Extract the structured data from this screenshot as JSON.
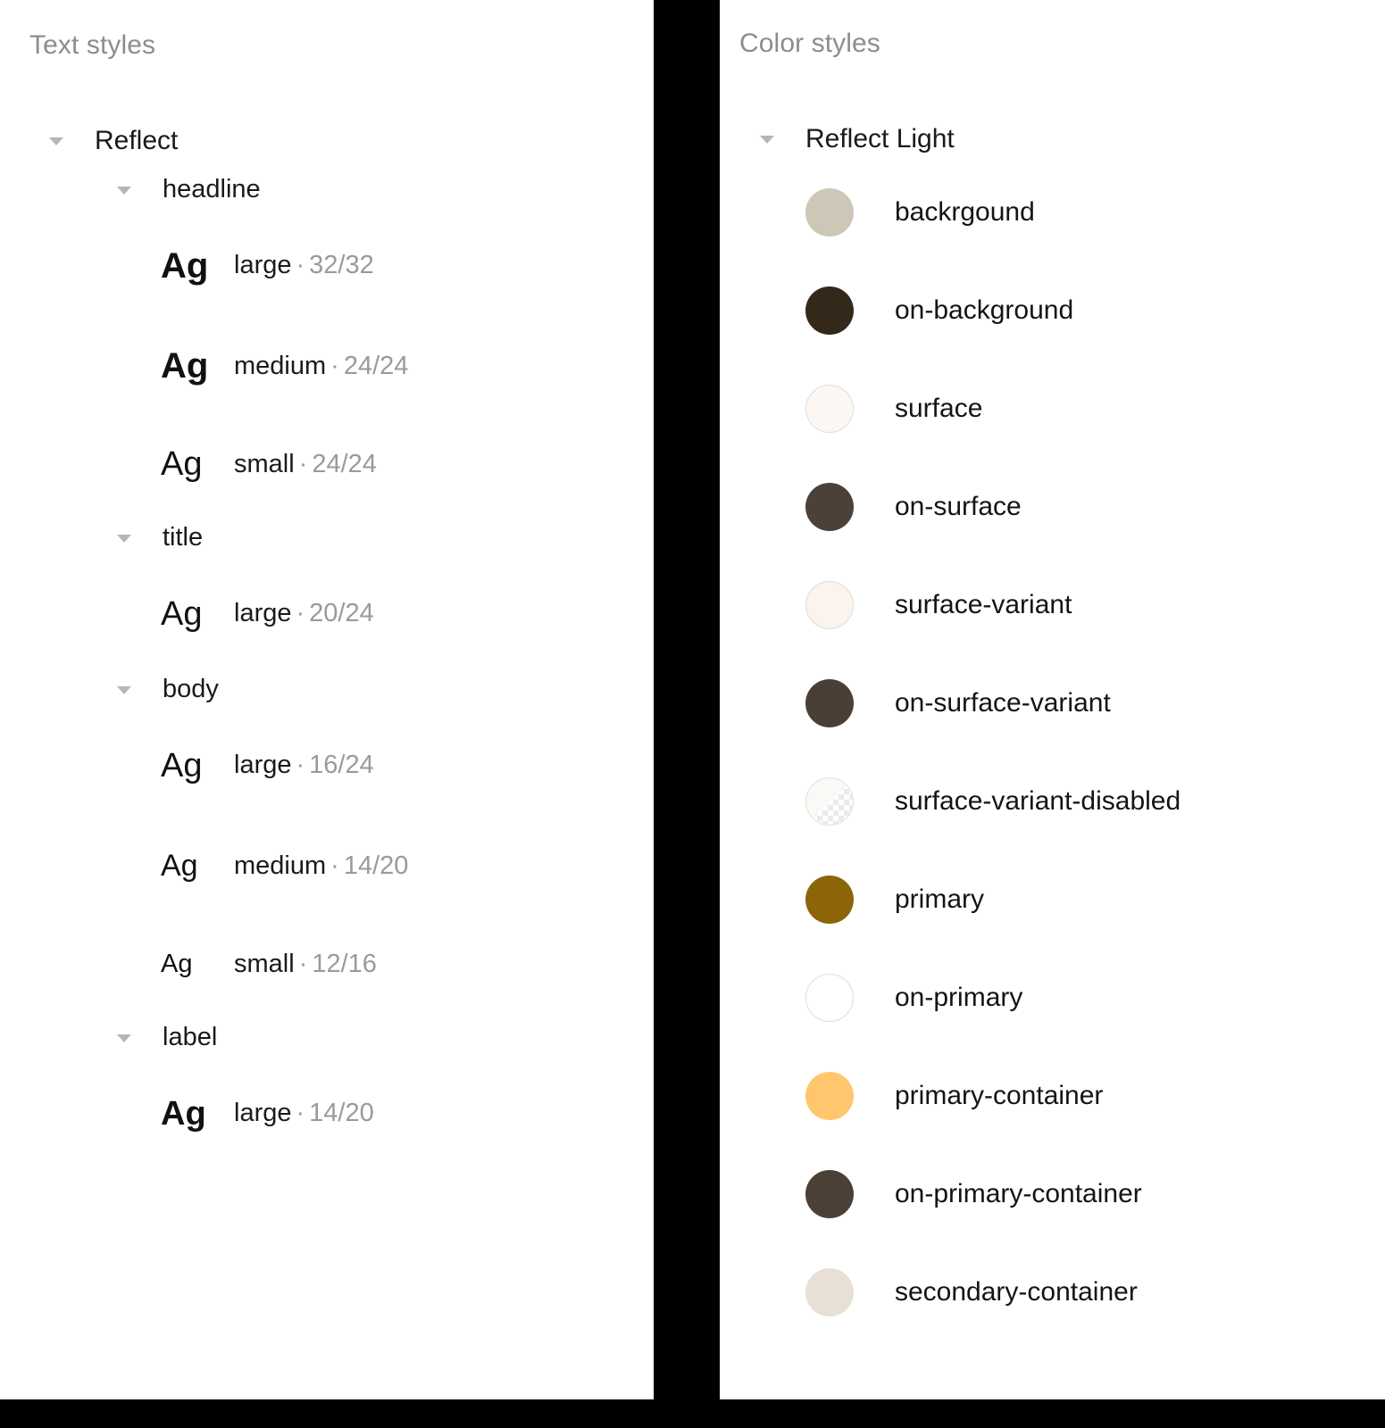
{
  "panels": {
    "text_styles": {
      "title": "Text styles",
      "root": {
        "label": "Reflect",
        "expanded": true,
        "caret_icon": "chevron-down-icon"
      },
      "groups": [
        {
          "label": "headline",
          "expanded": true,
          "items": [
            {
              "sample": "Ag",
              "name": "large",
              "separator": "·",
              "dims": "32/32",
              "weight": "bold",
              "size_class": "ag-size-32"
            },
            {
              "sample": "Ag",
              "name": "medium",
              "separator": "·",
              "dims": "24/24",
              "weight": "bold",
              "size_class": "ag-size-24"
            },
            {
              "sample": "Ag",
              "name": "small",
              "separator": "·",
              "dims": "24/24",
              "weight": "normal",
              "size_class": "ag-size-24s"
            }
          ]
        },
        {
          "label": "title",
          "expanded": true,
          "items": [
            {
              "sample": "Ag",
              "name": "large",
              "separator": "·",
              "dims": "20/24",
              "weight": "normal",
              "size_class": "ag-size-20"
            }
          ]
        },
        {
          "label": "body",
          "expanded": true,
          "items": [
            {
              "sample": "Ag",
              "name": "large",
              "separator": "·",
              "dims": "16/24",
              "weight": "normal",
              "size_class": "ag-size-16"
            },
            {
              "sample": "Ag",
              "name": "medium",
              "separator": "·",
              "dims": "14/20",
              "weight": "normal",
              "size_class": "ag-size-14"
            },
            {
              "sample": "Ag",
              "name": "small",
              "separator": "·",
              "dims": "12/16",
              "weight": "normal",
              "size_class": "ag-size-12"
            }
          ]
        },
        {
          "label": "label",
          "expanded": true,
          "items": [
            {
              "sample": "Ag",
              "name": "large",
              "separator": "·",
              "dims": "14/20",
              "weight": "bold",
              "size_class": "ag-size-l14"
            }
          ]
        }
      ]
    },
    "color_styles": {
      "title": "Color styles",
      "root": {
        "label": "Reflect Light",
        "expanded": true,
        "caret_icon": "chevron-down-icon"
      },
      "swatches": [
        {
          "name": "backrgound",
          "color": "#cdc7b8",
          "style": "solid"
        },
        {
          "name": "on-background",
          "color": "#33281a",
          "style": "solid"
        },
        {
          "name": "surface",
          "color": "#fcf7f3",
          "style": "bordered"
        },
        {
          "name": "on-surface",
          "color": "#4b4138",
          "style": "solid"
        },
        {
          "name": "surface-variant",
          "color": "#faf3ee",
          "style": "bordered"
        },
        {
          "name": "on-surface-variant",
          "color": "#4a3f36",
          "style": "solid"
        },
        {
          "name": "surface-variant-disabled",
          "color": "#fbf9f6",
          "style": "checker"
        },
        {
          "name": "primary",
          "color": "#8b6508",
          "style": "solid"
        },
        {
          "name": "on-primary",
          "color": "#ffffff",
          "style": "bordered"
        },
        {
          "name": "primary-container",
          "color": "#ffc66e",
          "style": "solid"
        },
        {
          "name": "on-primary-container",
          "color": "#4b4036",
          "style": "solid"
        },
        {
          "name": "secondary-container",
          "color": "#e8e0d4",
          "style": "solid"
        }
      ]
    }
  }
}
